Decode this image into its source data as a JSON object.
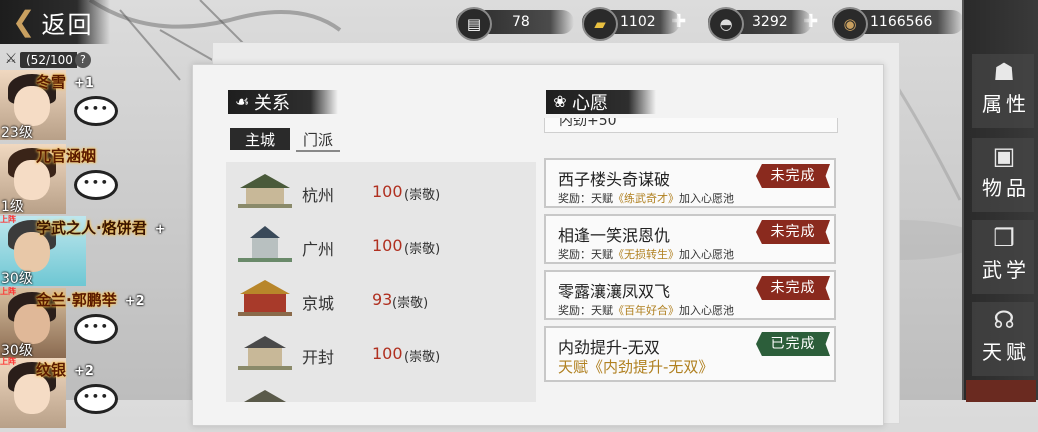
{
  "header": {
    "back_label": "返回",
    "resources": [
      {
        "icon": "jade-icon",
        "value": "78",
        "has_plus": false
      },
      {
        "icon": "gold-ingot-icon",
        "value": "1102",
        "has_plus": true
      },
      {
        "icon": "silver-ingot-icon",
        "value": "3292",
        "has_plus": true
      },
      {
        "icon": "coin-icon",
        "value": "1166566",
        "has_plus": false
      }
    ]
  },
  "party": {
    "count": "(52/100",
    "help": "?",
    "heroes": [
      {
        "name": "冬雪",
        "plus": "+1",
        "level": "23级",
        "badge": ""
      },
      {
        "name": "兀官涵姻",
        "plus": "",
        "level": "1级",
        "badge": ""
      },
      {
        "name": "学武之人·烙饼君",
        "plus": "+",
        "level": "30级",
        "badge": "上阵"
      },
      {
        "name": "金兰·郭鹏举",
        "plus": "+2",
        "level": "30级",
        "badge": "上阵"
      },
      {
        "name": "纹银",
        "plus": "+2",
        "level": "",
        "badge": "上阵"
      }
    ]
  },
  "relations": {
    "title": "关系",
    "tabs": [
      {
        "label": "主城",
        "active": true
      },
      {
        "label": "门派",
        "active": false
      }
    ],
    "rows": [
      {
        "city": "杭州",
        "value": "100",
        "rank": "(崇敬)"
      },
      {
        "city": "广州",
        "value": "100",
        "rank": "(崇敬)"
      },
      {
        "city": "京城",
        "value": "93",
        "rank": "(崇敬)"
      },
      {
        "city": "开封",
        "value": "100",
        "rank": "(崇敬)"
      }
    ]
  },
  "wishes": {
    "title": "心愿",
    "clipped_text": "内劲+50",
    "items": [
      {
        "title": "西子楼头奇谋破",
        "reward_prefix": "奖励：天赋",
        "reward_name": "《练武奇才》",
        "reward_suffix": "加入心愿池",
        "status": "未完成",
        "done": false
      },
      {
        "title": "相逢一笑泯恩仇",
        "reward_prefix": "奖励：天赋",
        "reward_name": "《无损转生》",
        "reward_suffix": "加入心愿池",
        "status": "未完成",
        "done": false
      },
      {
        "title": "零露瀼瀼凤双飞",
        "reward_prefix": "奖励：天赋",
        "reward_name": "《百年好合》",
        "reward_suffix": "加入心愿池",
        "status": "未完成",
        "done": false
      },
      {
        "title": "内劲提升-无双",
        "reward_line": "天赋《内劲提升-无双》",
        "status": "已完成",
        "done": true
      }
    ]
  },
  "side_menu": [
    {
      "label": "属性",
      "icon": "gourd-icon"
    },
    {
      "label": "物品",
      "icon": "box-icon"
    },
    {
      "label": "武学",
      "icon": "book-icon"
    },
    {
      "label": "天赋",
      "icon": "talent-icon"
    }
  ]
}
